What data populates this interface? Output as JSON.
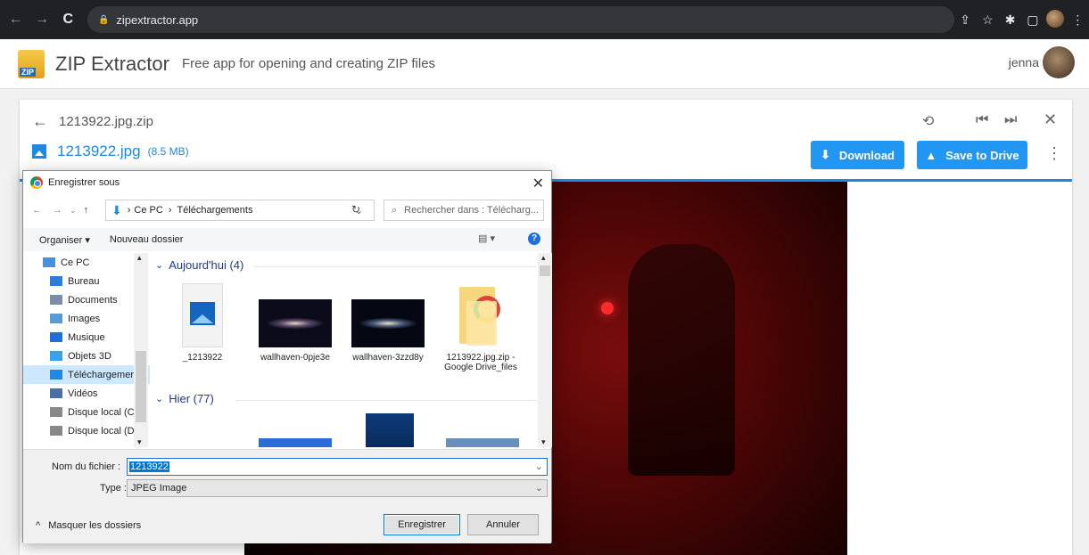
{
  "browser": {
    "url": "zipextractor.app"
  },
  "app": {
    "title": "ZIP Extractor",
    "subtitle": "Free app for opening and creating ZIP files",
    "logo_text": "ZIP",
    "user": "jenna"
  },
  "viewer": {
    "archive_name": "1213922.jpg.zip",
    "file_name": "1213922.jpg",
    "file_size": "(8.5 MB)",
    "download_label": "Download",
    "drive_label": "Save to Drive"
  },
  "dialog": {
    "title": "Enregistrer sous",
    "path": [
      "Ce PC",
      "Téléchargements"
    ],
    "search_placeholder": "Rechercher dans : Télécharg...",
    "organiser": "Organiser ▾",
    "new_folder": "Nouveau dossier",
    "nav": [
      {
        "label": "Ce PC",
        "icon": "computer-icon",
        "color": "#4a90d9"
      },
      {
        "label": "Bureau",
        "icon": "desktop-icon",
        "color": "#2b7fd6"
      },
      {
        "label": "Documents",
        "icon": "documents-icon",
        "color": "#7a8ea8"
      },
      {
        "label": "Images",
        "icon": "images-icon",
        "color": "#5a9bd4"
      },
      {
        "label": "Musique",
        "icon": "music-icon",
        "color": "#1e6fd9"
      },
      {
        "label": "Objets 3D",
        "icon": "objects3d-icon",
        "color": "#3aa0e8"
      },
      {
        "label": "Téléchargements",
        "icon": "downloads-icon",
        "color": "#1e88e5"
      },
      {
        "label": "Vidéos",
        "icon": "videos-icon",
        "color": "#4a6fa5"
      },
      {
        "label": "Disque local (C:)",
        "icon": "drive-icon",
        "color": "#888888"
      },
      {
        "label": "Disque local (D:)",
        "icon": "drive-icon",
        "color": "#888888"
      }
    ],
    "groups": [
      {
        "label": "Aujourd'hui (4)"
      },
      {
        "label": "Hier (77)"
      }
    ],
    "files": [
      {
        "name": "_1213922",
        "kind": "image-file"
      },
      {
        "name": "wallhaven-0pje3e",
        "kind": "galaxy"
      },
      {
        "name": "wallhaven-3zzd8y",
        "kind": "galaxy"
      },
      {
        "name": "1213922.jpg.zip - Google Drive_files",
        "kind": "folder"
      }
    ],
    "filename_label": "Nom du fichier :",
    "filename_value": "1213922",
    "type_label": "Type :",
    "type_value": "JPEG Image",
    "hide_folders": "Masquer les dossiers",
    "save_label": "Enregistrer",
    "cancel_label": "Annuler"
  }
}
